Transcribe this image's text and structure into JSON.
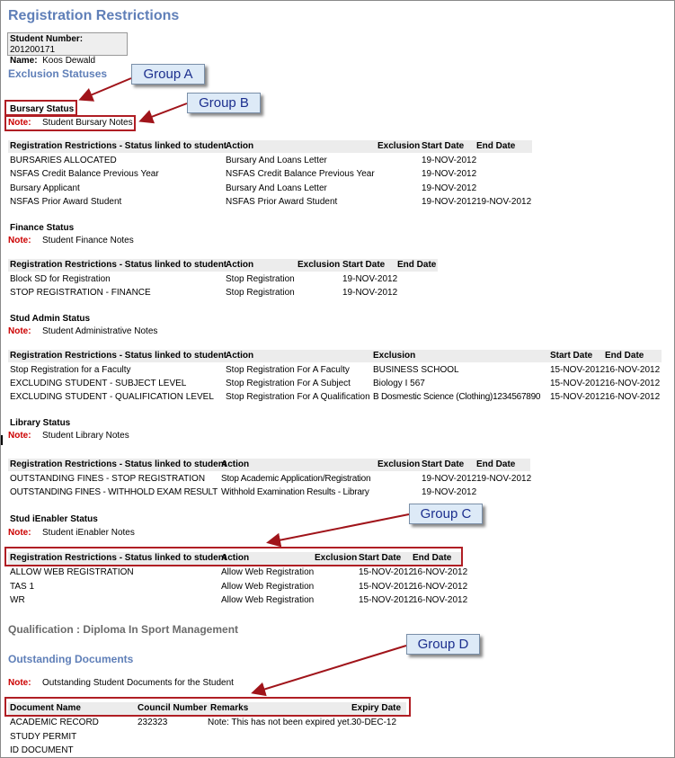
{
  "page_title": "Registration Restrictions",
  "student": {
    "number_label": "Student Number:",
    "number_value": "201200171",
    "name_label": "Name:",
    "name_value": "Koos Dewald"
  },
  "exclusion_title": "Exclusion Statuses",
  "note_label": "Note:",
  "callouts": {
    "a": "Group A",
    "b": "Group B",
    "c": "Group C",
    "d": "Group D"
  },
  "bursary": {
    "title": "Bursary Status",
    "note": "Student Bursary Notes",
    "headers": [
      "Registration Restrictions - Status linked to student",
      "Action",
      "Exclusion",
      "Start Date",
      "End Date"
    ],
    "rows": [
      [
        "BURSARIES ALLOCATED",
        "Bursary And Loans Letter",
        "",
        "19-NOV-2012",
        ""
      ],
      [
        "NSFAS Credit Balance Previous Year",
        "NSFAS Credit Balance Previous Year",
        "",
        "19-NOV-2012",
        ""
      ],
      [
        "Bursary Applicant",
        "Bursary And Loans Letter",
        "",
        "19-NOV-2012",
        ""
      ],
      [
        "NSFAS Prior Award Student",
        "NSFAS Prior Award Student",
        "",
        "19-NOV-2012",
        "19-NOV-2012"
      ]
    ]
  },
  "finance": {
    "title": "Finance Status",
    "note": "Student Finance Notes",
    "headers": [
      "Registration Restrictions - Status linked to student",
      "Action",
      "Exclusion",
      "Start Date",
      "End Date"
    ],
    "rows": [
      [
        "Block SD for Registration",
        "Stop Registration",
        "",
        "19-NOV-2012",
        ""
      ],
      [
        "STOP REGISTRATION - FINANCE",
        "Stop Registration",
        "",
        "19-NOV-2012",
        ""
      ]
    ]
  },
  "stud_admin": {
    "title": "Stud Admin Status",
    "note": "Student Administrative Notes",
    "headers": [
      "Registration Restrictions - Status linked to student",
      "Action",
      "Exclusion",
      "Start Date",
      "End Date"
    ],
    "rows": [
      [
        "Stop Registration for a Faculty",
        "Stop Registration For A Faculty",
        "BUSINESS SCHOOL",
        "15-NOV-2012",
        "16-NOV-2012"
      ],
      [
        "EXCLUDING STUDENT - SUBJECT LEVEL",
        "Stop Registration For A Subject",
        "Biology I 567",
        "15-NOV-2012",
        "16-NOV-2012"
      ],
      [
        "EXCLUDING STUDENT - QUALIFICATION LEVEL",
        "Stop Registration For A Qualification",
        "B Dosmestic Science (Clothing)1234567890",
        "15-NOV-2012",
        "16-NOV-2012"
      ]
    ]
  },
  "library": {
    "title": "Library Status",
    "note": "Student Library Notes",
    "headers": [
      "Registration Restrictions - Status linked to student",
      "Action",
      "Exclusion",
      "Start Date",
      "End Date"
    ],
    "rows": [
      [
        "OUTSTANDING FINES - STOP REGISTRATION",
        "Stop Academic Application/Registration",
        "",
        "19-NOV-2012",
        "19-NOV-2012"
      ],
      [
        "OUTSTANDING FINES - WITHHOLD EXAM RESULT",
        "Withhold Examination Results - Library",
        "",
        "19-NOV-2012",
        ""
      ]
    ]
  },
  "ienabler": {
    "title": "Stud iEnabler Status",
    "note": "Student iEnabler Notes",
    "headers": [
      "Registration Restrictions - Status linked to student",
      "Action",
      "Exclusion",
      "Start Date",
      "End Date"
    ],
    "rows": [
      [
        "ALLOW WEB REGISTRATION",
        "Allow Web Registration",
        "",
        "15-NOV-2012",
        "16-NOV-2012"
      ],
      [
        "TAS 1",
        "Allow Web Registration",
        "",
        "15-NOV-2012",
        "16-NOV-2012"
      ],
      [
        "WR",
        "Allow Web Registration",
        "",
        "15-NOV-2012",
        "16-NOV-2012"
      ]
    ]
  },
  "qualification": "Qualification : Diploma In Sport Management",
  "documents": {
    "title": "Outstanding Documents",
    "note": "Outstanding Student Documents for the Student",
    "headers": [
      "Document Name",
      "Council Number",
      "Remarks",
      "Expiry Date"
    ],
    "rows": [
      [
        "ACADEMIC RECORD",
        "232323",
        "Note: This has not been expired yet.",
        "30-DEC-12"
      ],
      [
        "STUDY PERMIT",
        "",
        "",
        ""
      ],
      [
        "ID DOCUMENT",
        "",
        "",
        ""
      ]
    ]
  }
}
